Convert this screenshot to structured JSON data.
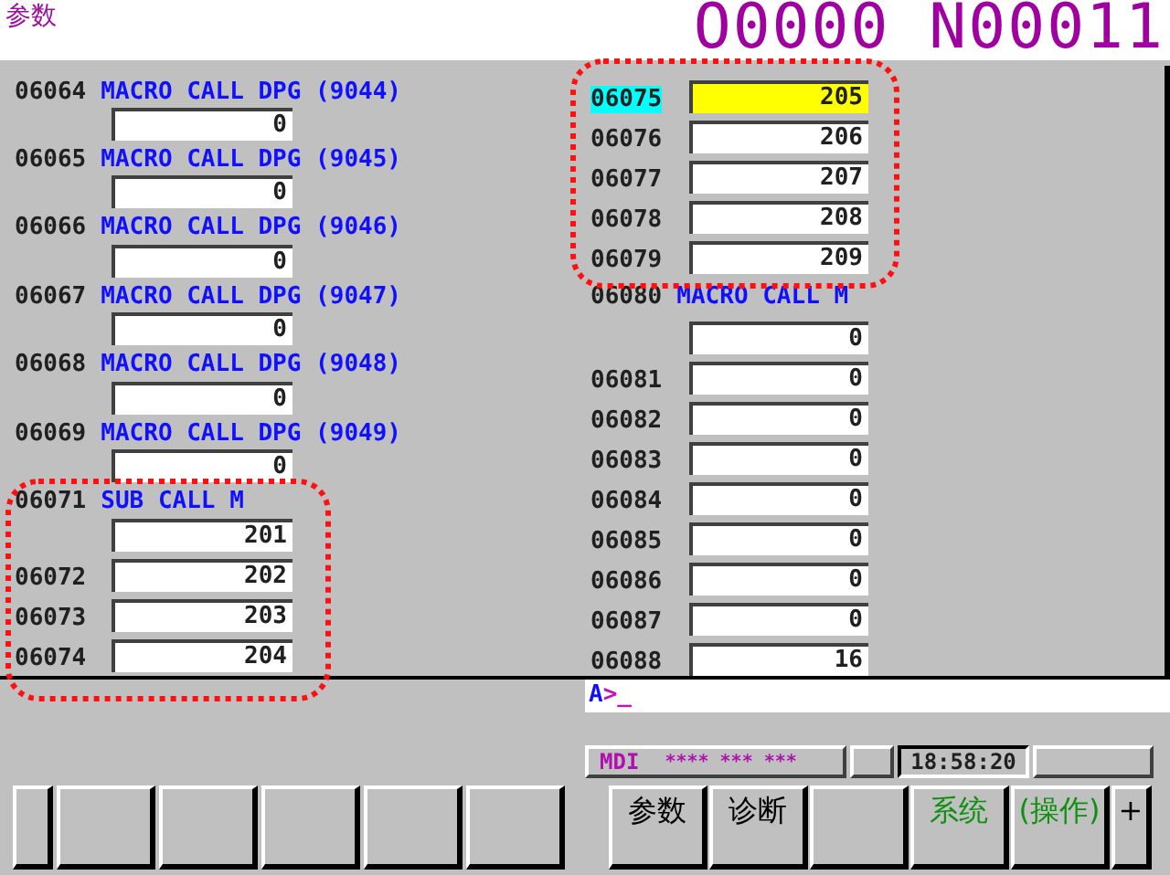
{
  "screen_title": "参数",
  "program": "O0000 N00011",
  "left_params": [
    {
      "number": "06064",
      "name": "MACRO CALL DPG (9044)",
      "value": "0",
      "selected": false
    },
    {
      "number": "06065",
      "name": "MACRO CALL DPG (9045)",
      "value": "0",
      "selected": false
    },
    {
      "number": "06066",
      "name": "MACRO CALL DPG (9046)",
      "value": "0",
      "selected": false
    },
    {
      "number": "06067",
      "name": "MACRO CALL DPG (9047)",
      "value": "0",
      "selected": false
    },
    {
      "number": "06068",
      "name": "MACRO CALL DPG (9048)",
      "value": "0",
      "selected": false
    },
    {
      "number": "06069",
      "name": "MACRO CALL DPG (9049)",
      "value": "0",
      "selected": false
    },
    {
      "number": "06071",
      "name": "SUB CALL M",
      "value": "201",
      "selected": false
    },
    {
      "number": "06072",
      "value": "202",
      "selected": false
    },
    {
      "number": "06073",
      "value": "203",
      "selected": false
    },
    {
      "number": "06074",
      "value": "204",
      "selected": false
    }
  ],
  "right_params": [
    {
      "number": "06075",
      "value": "205",
      "selected": true
    },
    {
      "number": "06076",
      "value": "206",
      "selected": false
    },
    {
      "number": "06077",
      "value": "207",
      "selected": false
    },
    {
      "number": "06078",
      "value": "208",
      "selected": false
    },
    {
      "number": "06079",
      "value": "209",
      "selected": false
    },
    {
      "number": "06080",
      "name": "MACRO CALL M",
      "value": "0",
      "selected": false
    },
    {
      "number": "06081",
      "value": "0",
      "selected": false
    },
    {
      "number": "06082",
      "value": "0",
      "selected": false
    },
    {
      "number": "06083",
      "value": "0",
      "selected": false
    },
    {
      "number": "06084",
      "value": "0",
      "selected": false
    },
    {
      "number": "06085",
      "value": "0",
      "selected": false
    },
    {
      "number": "06086",
      "value": "0",
      "selected": false
    },
    {
      "number": "06087",
      "value": "0",
      "selected": false
    },
    {
      "number": "06088",
      "value": "16",
      "selected": false
    }
  ],
  "command_line": {
    "prompt": "A",
    "text": ">_"
  },
  "status_bar": {
    "mode": "MDI",
    "flags": "**** *** ***",
    "time": "18:58:20"
  },
  "softkeys_left": [
    {
      "kind": "blank"
    },
    {
      "kind": "blank"
    },
    {
      "kind": "blank"
    },
    {
      "kind": "blank"
    },
    {
      "kind": "blank"
    },
    {
      "kind": "blank"
    }
  ],
  "softkeys_right": [
    {
      "kind": "label",
      "label": "参数",
      "color": "#000000"
    },
    {
      "kind": "label",
      "label": "诊断",
      "color": "#000000"
    },
    {
      "kind": "blank"
    },
    {
      "kind": "label",
      "label": "系统",
      "color": "#109010"
    },
    {
      "kind": "label",
      "label": "(操作)",
      "color": "#109010"
    },
    {
      "kind": "label",
      "label": "+",
      "color": "#000000"
    }
  ]
}
